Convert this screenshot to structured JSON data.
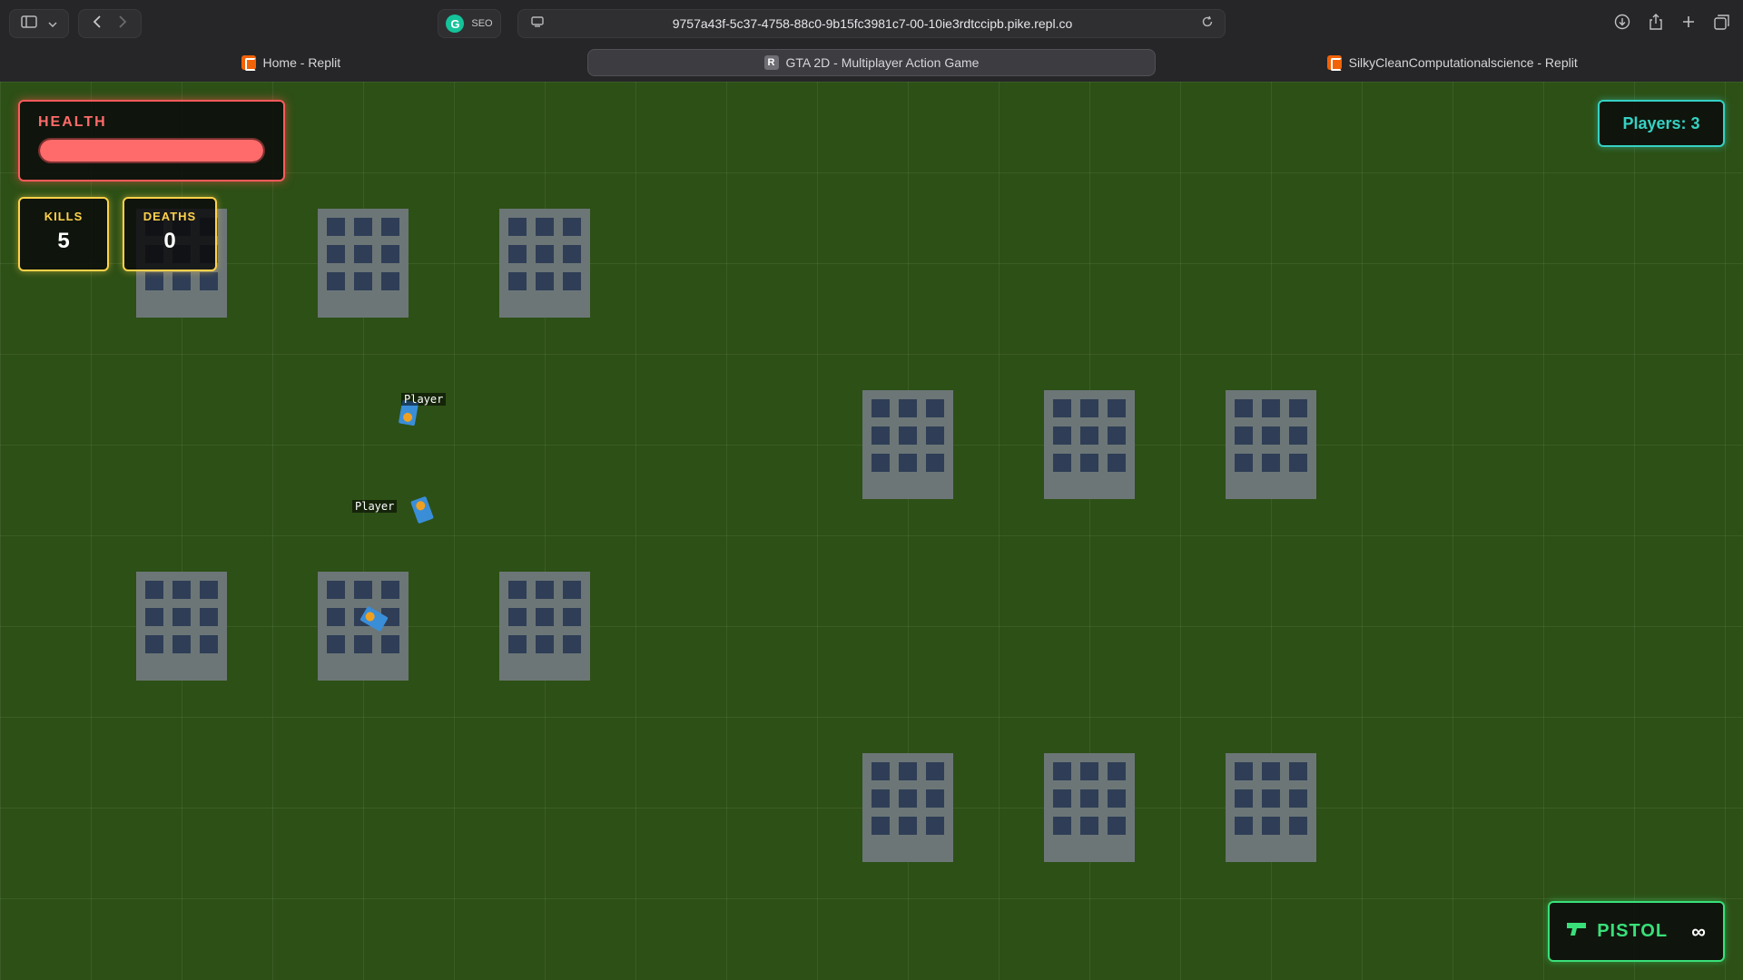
{
  "browser": {
    "url": "9757a43f-5c37-4758-88c0-9b15fc3981c7-00-10ie3rdtccipb.pike.repl.co",
    "extension_label": "SEO",
    "tabs": [
      {
        "label": "Home - Replit",
        "favicon": "replit-icon",
        "active": false
      },
      {
        "label": "GTA 2D - Multiplayer Action Game",
        "favicon": "r-icon",
        "active": true
      },
      {
        "label": "SilkyCleanComputationalscience - Replit",
        "favicon": "replit-icon",
        "active": false
      }
    ]
  },
  "hud": {
    "health_label": "HEALTH",
    "health_fraction": 1.0,
    "kills_label": "KILLS",
    "kills_value": "5",
    "deaths_label": "DEATHS",
    "deaths_value": "0",
    "players_text": "Players: 3",
    "weapon_name": "PISTOL",
    "ammo": "∞"
  },
  "players": [
    {
      "label": "Player"
    },
    {
      "label": "Player"
    },
    {
      "label": ""
    }
  ],
  "colors": {
    "ground": "#2d5016",
    "building": "#6c7677",
    "window": "#2f3e56",
    "player": "#3a8ed8",
    "health": "#ff6b6b",
    "stats": "#ffd24a",
    "players_counter": "#36d1c4",
    "weapon": "#39e07a"
  }
}
